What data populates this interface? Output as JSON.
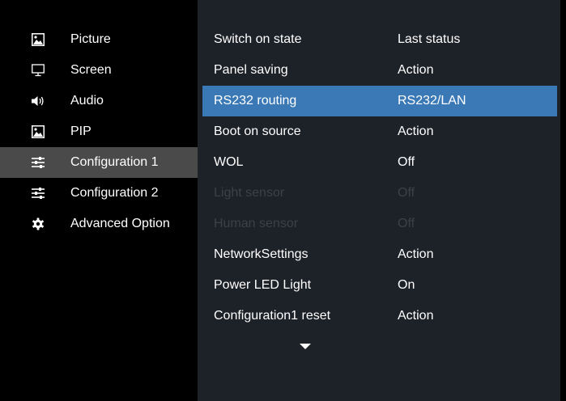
{
  "sidebar": {
    "items": [
      {
        "label": "Picture",
        "icon": "picture-icon",
        "selected": false
      },
      {
        "label": "Screen",
        "icon": "monitor-icon",
        "selected": false
      },
      {
        "label": "Audio",
        "icon": "speaker-icon",
        "selected": false
      },
      {
        "label": "PIP",
        "icon": "pip-icon",
        "selected": false
      },
      {
        "label": "Configuration 1",
        "icon": "sliders-icon",
        "selected": true
      },
      {
        "label": "Configuration 2",
        "icon": "sliders-icon",
        "selected": false
      },
      {
        "label": "Advanced Option",
        "icon": "gear-icon",
        "selected": false
      }
    ]
  },
  "settings": {
    "rows": [
      {
        "label": "Switch on state",
        "value": "Last status",
        "state": "normal"
      },
      {
        "label": "Panel saving",
        "value": "Action",
        "state": "normal"
      },
      {
        "label": "RS232 routing",
        "value": "RS232/LAN",
        "state": "highlighted"
      },
      {
        "label": "Boot on source",
        "value": "Action",
        "state": "normal"
      },
      {
        "label": "WOL",
        "value": "Off",
        "state": "normal"
      },
      {
        "label": "Light sensor",
        "value": "Off",
        "state": "disabled"
      },
      {
        "label": "Human sensor",
        "value": "Off",
        "state": "disabled"
      },
      {
        "label": "NetworkSettings",
        "value": "Action",
        "state": "normal"
      },
      {
        "label": "Power LED Light",
        "value": "On",
        "state": "normal"
      },
      {
        "label": "Configuration1 reset",
        "value": "Action",
        "state": "normal"
      }
    ],
    "scroll_icon": "chevron-down-icon"
  },
  "colors": {
    "background": "#000000",
    "panel": "#1d2128",
    "highlight": "#3a79b6",
    "sidebar_selected": "#4a4a4a",
    "disabled_text": "#3c4048"
  }
}
